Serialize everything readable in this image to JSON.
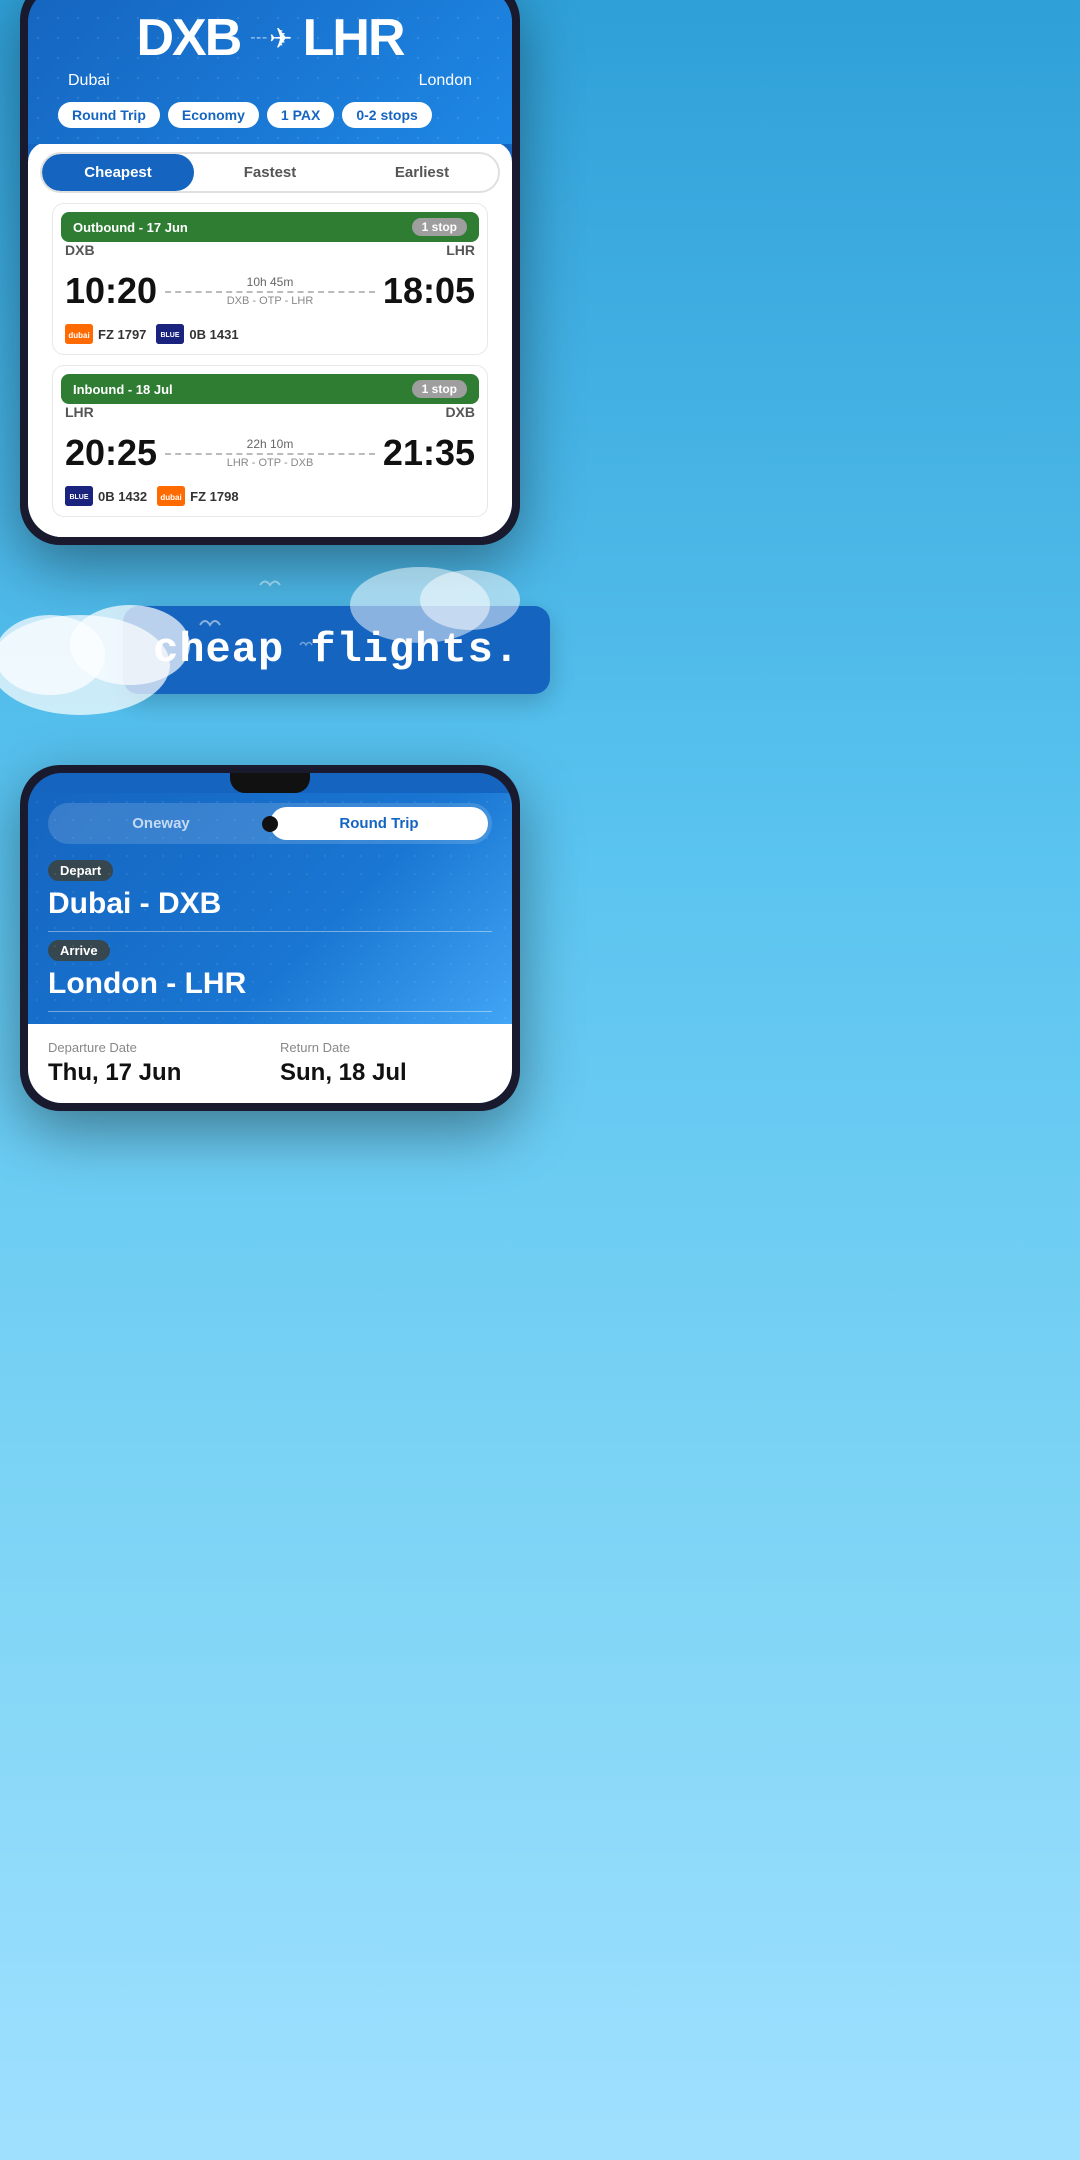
{
  "page": {
    "bg_color": "#3aabde"
  },
  "phone1": {
    "origin_code": "DXB",
    "destination_code": "LHR",
    "origin_city": "Dubai",
    "destination_city": "London",
    "pills": [
      "Round Trip",
      "Economy",
      "1 PAX",
      "0-2 stops"
    ],
    "tabs": [
      "Cheapest",
      "Fastest",
      "Earliest"
    ],
    "active_tab": "Cheapest",
    "outbound": {
      "label": "Outbound - 17 Jun",
      "stop_badge": "1 stop",
      "from": "DXB",
      "to": "LHR",
      "depart_time": "10:20",
      "arrive_time": "18:05",
      "duration": "10h 45m",
      "route": "DXB - OTP - LHR",
      "airlines": [
        {
          "code": "FZ 1797",
          "color": "orange"
        },
        {
          "code": "0B 1431",
          "color": "blue"
        }
      ]
    },
    "inbound": {
      "label": "Inbound - 18 Jul",
      "stop_badge": "1 stop",
      "from": "LHR",
      "to": "DXB",
      "depart_time": "20:25",
      "arrive_time": "21:35",
      "duration": "22h 10m",
      "route": "LHR - OTP - DXB",
      "airlines": [
        {
          "code": "0B 1432",
          "color": "blue"
        },
        {
          "code": "FZ 1798",
          "color": "orange"
        }
      ]
    }
  },
  "banner": {
    "text": "cheap flights."
  },
  "phone2": {
    "trip_options": [
      "Oneway",
      "Round Trip"
    ],
    "active_trip": "Round Trip",
    "depart_label": "Depart",
    "depart_value": "Dubai - DXB",
    "arrive_label": "Arrive",
    "arrive_value": "London - LHR",
    "departure_date_label": "Departure Date",
    "departure_date": "Thu, 17 Jun",
    "return_date_label": "Return Date",
    "return_date": "Sun, 18 Jul"
  }
}
